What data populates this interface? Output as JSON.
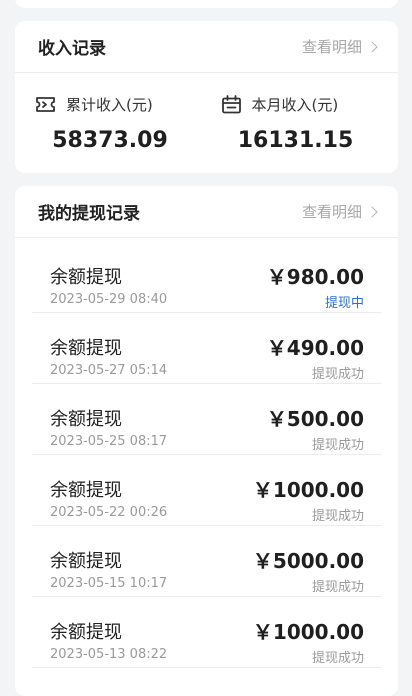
{
  "income": {
    "title": "收入记录",
    "detail_label": "查看明细",
    "total_label": "累计收入(元)",
    "total_value": "58373.09",
    "month_label": "本月收入(元)",
    "month_value": "16131.15",
    "total_icon": "ticket-icon",
    "month_icon": "calendar-icon"
  },
  "withdraw": {
    "title": "我的提现记录",
    "detail_label": "查看明细",
    "rows": [
      {
        "title": "余额提现",
        "date": "2023-05-29 08:40",
        "amount": "￥980.00",
        "status": "提现中",
        "status_color": "#2a6fd6"
      },
      {
        "title": "余额提现",
        "date": "2023-05-27 05:14",
        "amount": "￥490.00",
        "status": "提现成功",
        "status_color": "#9a9a9a"
      },
      {
        "title": "余额提现",
        "date": "2023-05-25 08:17",
        "amount": "￥500.00",
        "status": "提现成功",
        "status_color": "#9a9a9a"
      },
      {
        "title": "余额提现",
        "date": "2023-05-22 00:26",
        "amount": "￥1000.00",
        "status": "提现成功",
        "status_color": "#9a9a9a"
      },
      {
        "title": "余额提现",
        "date": "2023-05-15 10:17",
        "amount": "￥5000.00",
        "status": "提现成功",
        "status_color": "#9a9a9a"
      },
      {
        "title": "余额提现",
        "date": "2023-05-13 08:22",
        "amount": "￥1000.00",
        "status": "提现成功",
        "status_color": "#9a9a9a"
      }
    ]
  }
}
